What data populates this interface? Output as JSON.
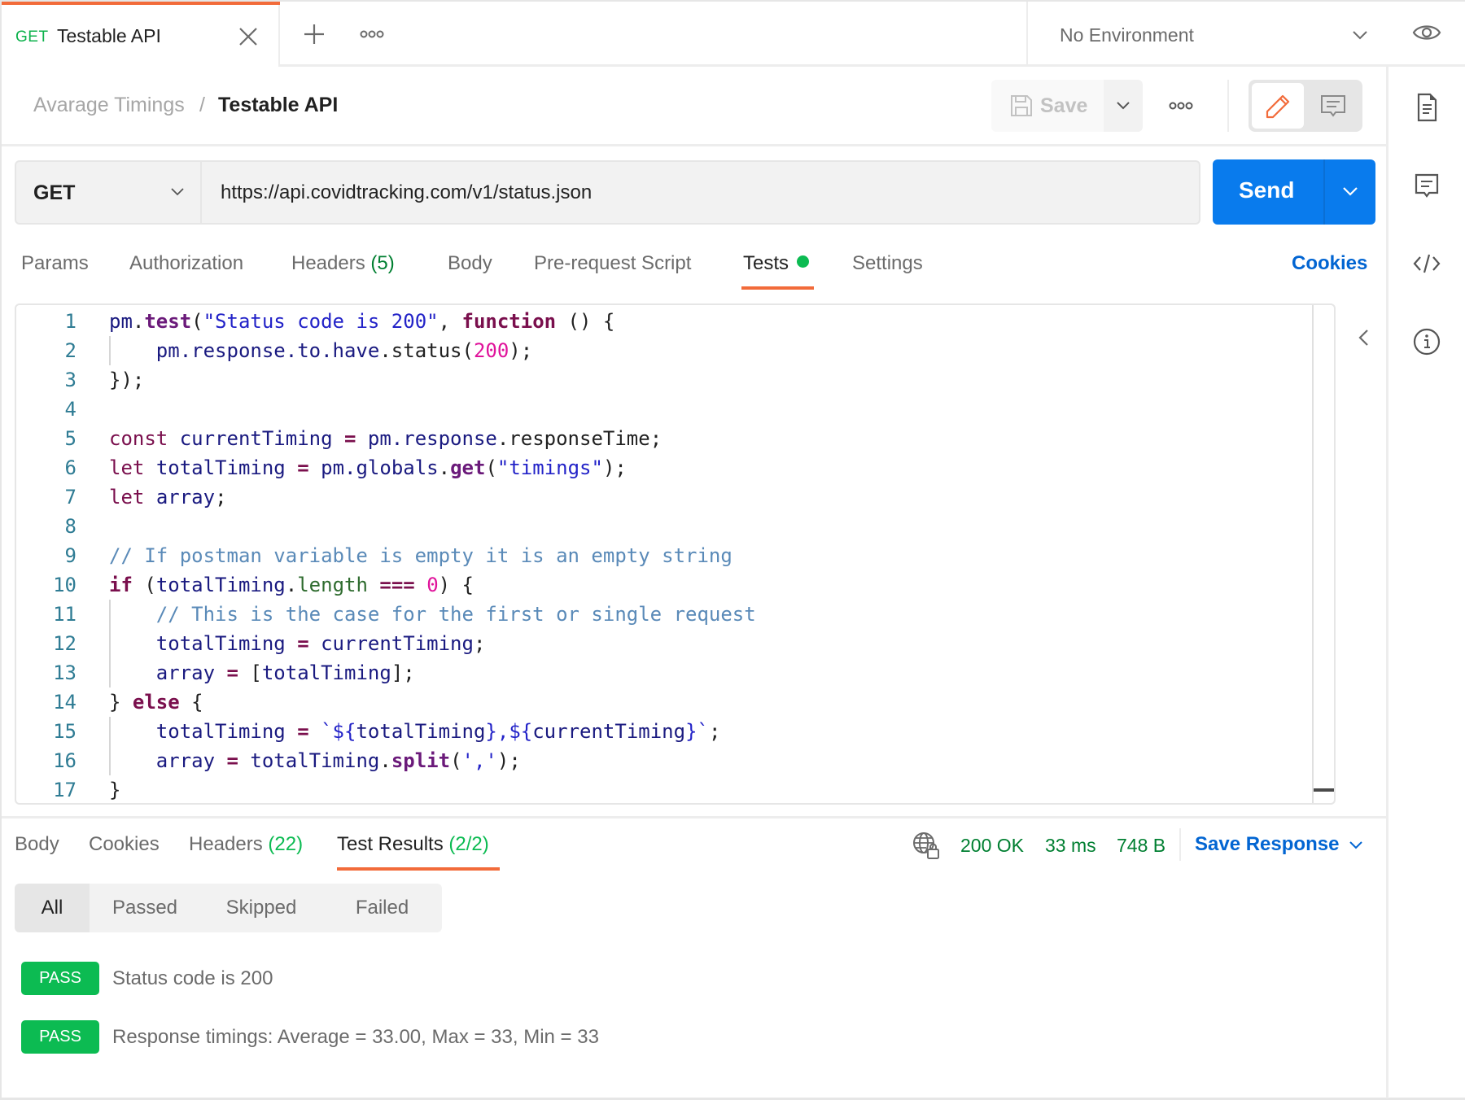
{
  "tabs": {
    "active": {
      "method": "GET",
      "title": "Testable API"
    },
    "new_tab_icon": "plus-icon",
    "more_icon": "ellipsis-icon"
  },
  "environment": {
    "selected": "No Environment"
  },
  "breadcrumb": {
    "parent": "Avarage Timings",
    "separator": "/",
    "current": "Testable API"
  },
  "toolbar": {
    "save_label": "Save"
  },
  "request": {
    "method": "GET",
    "url": "https://api.covidtracking.com/v1/status.json",
    "send_label": "Send"
  },
  "request_tabs": [
    {
      "label": "Params"
    },
    {
      "label": "Authorization"
    },
    {
      "label": "Headers",
      "count": "(5)"
    },
    {
      "label": "Body"
    },
    {
      "label": "Pre-request Script"
    },
    {
      "label": "Tests",
      "active": true,
      "indicator": "green-dot"
    },
    {
      "label": "Settings"
    }
  ],
  "cookies_link": "Cookies",
  "editor": {
    "lines": [
      {
        "n": "1",
        "tokens": [
          [
            "k-id",
            "pm"
          ],
          [
            "k-plain",
            "."
          ],
          [
            "k-fn",
            "test"
          ],
          [
            "k-plain",
            "("
          ],
          [
            "k-str",
            "\"Status code is 200\""
          ],
          [
            "k-plain",
            ", "
          ],
          [
            "k-kw",
            "function"
          ],
          [
            "k-plain",
            " () {"
          ]
        ]
      },
      {
        "n": "2",
        "guide": true,
        "tokens": [
          [
            "k-plain",
            "    "
          ],
          [
            "k-id",
            "pm.response.to.have"
          ],
          [
            "k-plain",
            ".status("
          ],
          [
            "k-num",
            "200"
          ],
          [
            "k-plain",
            ");"
          ]
        ]
      },
      {
        "n": "3",
        "tokens": [
          [
            "k-plain",
            "});"
          ]
        ]
      },
      {
        "n": "4",
        "tokens": []
      },
      {
        "n": "5",
        "tokens": [
          [
            "k-decl",
            "const"
          ],
          [
            "k-plain",
            " "
          ],
          [
            "k-id",
            "currentTiming"
          ],
          [
            "k-plain",
            " "
          ],
          [
            "k-op",
            "="
          ],
          [
            "k-plain",
            " "
          ],
          [
            "k-id",
            "pm.response"
          ],
          [
            "k-plain",
            ".responseTime;"
          ]
        ]
      },
      {
        "n": "6",
        "tokens": [
          [
            "k-decl",
            "let"
          ],
          [
            "k-plain",
            " "
          ],
          [
            "k-id",
            "totalTiming"
          ],
          [
            "k-plain",
            " "
          ],
          [
            "k-op",
            "="
          ],
          [
            "k-plain",
            " "
          ],
          [
            "k-id",
            "pm.globals"
          ],
          [
            "k-plain",
            "."
          ],
          [
            "k-fn",
            "get"
          ],
          [
            "k-plain",
            "("
          ],
          [
            "k-str",
            "\"timings\""
          ],
          [
            "k-plain",
            ");"
          ]
        ]
      },
      {
        "n": "7",
        "tokens": [
          [
            "k-decl",
            "let"
          ],
          [
            "k-plain",
            " "
          ],
          [
            "k-id",
            "array"
          ],
          [
            "k-plain",
            ";"
          ]
        ]
      },
      {
        "n": "8",
        "tokens": []
      },
      {
        "n": "9",
        "tokens": [
          [
            "k-com",
            "// If postman variable is empty it is an empty string"
          ]
        ]
      },
      {
        "n": "10",
        "tokens": [
          [
            "k-kw",
            "if"
          ],
          [
            "k-plain",
            " ("
          ],
          [
            "k-id",
            "totalTiming"
          ],
          [
            "k-plain",
            "."
          ],
          [
            "k-prop",
            "length"
          ],
          [
            "k-plain",
            " "
          ],
          [
            "k-op",
            "==="
          ],
          [
            "k-plain",
            " "
          ],
          [
            "k-num",
            "0"
          ],
          [
            "k-plain",
            ") {"
          ]
        ]
      },
      {
        "n": "11",
        "guide": true,
        "tokens": [
          [
            "k-plain",
            "    "
          ],
          [
            "k-com",
            "// This is the case for the first or single request"
          ]
        ]
      },
      {
        "n": "12",
        "guide": true,
        "tokens": [
          [
            "k-plain",
            "    "
          ],
          [
            "k-id",
            "totalTiming"
          ],
          [
            "k-plain",
            " "
          ],
          [
            "k-op",
            "="
          ],
          [
            "k-plain",
            " "
          ],
          [
            "k-id",
            "currentTiming"
          ],
          [
            "k-plain",
            ";"
          ]
        ]
      },
      {
        "n": "13",
        "guide": true,
        "tokens": [
          [
            "k-plain",
            "    "
          ],
          [
            "k-id",
            "array"
          ],
          [
            "k-plain",
            " "
          ],
          [
            "k-op",
            "="
          ],
          [
            "k-plain",
            " ["
          ],
          [
            "k-id",
            "totalTiming"
          ],
          [
            "k-plain",
            "];"
          ]
        ]
      },
      {
        "n": "14",
        "tokens": [
          [
            "k-plain",
            "} "
          ],
          [
            "k-kw",
            "else"
          ],
          [
            "k-plain",
            " {"
          ]
        ]
      },
      {
        "n": "15",
        "guide": true,
        "tokens": [
          [
            "k-plain",
            "    "
          ],
          [
            "k-id",
            "totalTiming"
          ],
          [
            "k-plain",
            " "
          ],
          [
            "k-op",
            "="
          ],
          [
            "k-plain",
            " "
          ],
          [
            "k-str",
            "`${"
          ],
          [
            "k-id",
            "totalTiming"
          ],
          [
            "k-str",
            "},${"
          ],
          [
            "k-id",
            "currentTiming"
          ],
          [
            "k-str",
            "}`"
          ],
          [
            "k-plain",
            ";"
          ]
        ]
      },
      {
        "n": "16",
        "guide": true,
        "tokens": [
          [
            "k-plain",
            "    "
          ],
          [
            "k-id",
            "array"
          ],
          [
            "k-plain",
            " "
          ],
          [
            "k-op",
            "="
          ],
          [
            "k-plain",
            " "
          ],
          [
            "k-id",
            "totalTiming"
          ],
          [
            "k-plain",
            "."
          ],
          [
            "k-fn",
            "split"
          ],
          [
            "k-plain",
            "("
          ],
          [
            "k-str",
            "','"
          ],
          [
            "k-plain",
            ");"
          ]
        ]
      },
      {
        "n": "17",
        "tokens": [
          [
            "k-plain",
            "}"
          ]
        ]
      }
    ]
  },
  "response": {
    "tabs": [
      {
        "label": "Body"
      },
      {
        "label": "Cookies"
      },
      {
        "label": "Headers",
        "count": "(22)"
      },
      {
        "label": "Test Results",
        "count": "(2/2)",
        "active": true
      }
    ],
    "status": "200 OK",
    "time": "33 ms",
    "size": "748 B",
    "save_response_label": "Save Response"
  },
  "filters": [
    {
      "label": "All",
      "active": true
    },
    {
      "label": "Passed"
    },
    {
      "label": "Skipped"
    },
    {
      "label": "Failed"
    }
  ],
  "test_results": [
    {
      "status": "PASS",
      "name": "Status code is 200"
    },
    {
      "status": "PASS",
      "name": "Response timings: Average = 33.00, Max = 33, Min = 33"
    }
  ],
  "colors": {
    "accent_orange": "#f26b3a",
    "send_blue": "#097bed",
    "link_blue": "#0265d2",
    "pass_green": "#0cbb52",
    "status_green": "#007f31"
  }
}
